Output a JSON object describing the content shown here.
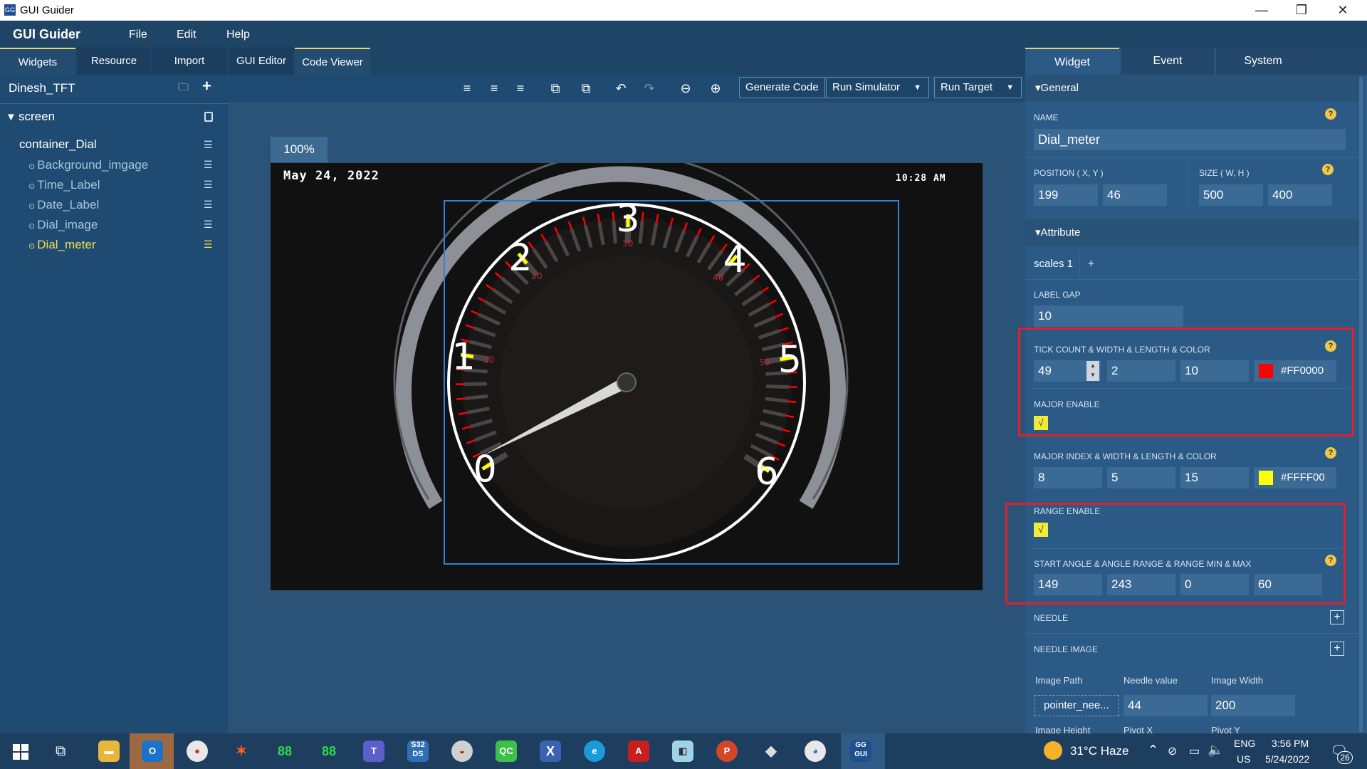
{
  "window": {
    "title": "GUI Guider",
    "minimize": "—",
    "restore": "❐",
    "close": "✕"
  },
  "menu": {
    "brand": "GUI Guider",
    "items": [
      "File",
      "Edit",
      "Help"
    ]
  },
  "left_tabs": [
    "Widgets",
    "Resource",
    "Import"
  ],
  "editor_tabs": [
    "GUI Editor",
    "Code Viewer"
  ],
  "project": {
    "name": "Dinesh_TFT"
  },
  "tree": {
    "root": "screen",
    "container": "container_Dial",
    "children": [
      "Background_imgage",
      "Time_Label",
      "Date_Label",
      "Dial_image",
      "Dial_meter"
    ]
  },
  "toolbar": {
    "generate": "Generate Code",
    "run_sim": "Run Simulator",
    "run_target": "Run Target"
  },
  "canvas": {
    "zoom": "100%",
    "date": "May 24, 2022",
    "time": "10:28 AM",
    "dial_labels": [
      "0",
      "1",
      "2",
      "3",
      "4",
      "5",
      "6"
    ],
    "dial_small_labels": [
      "10",
      "20",
      "30",
      "40",
      "50"
    ]
  },
  "right_tabs": [
    "Widget",
    "Event",
    "System"
  ],
  "general": {
    "header": "General",
    "name_label": "NAME",
    "name_value": "Dial_meter",
    "pos_label": "POSITION ( X, Y )",
    "pos_x": "199",
    "pos_y": "46",
    "size_label": "SIZE ( W, H )",
    "size_w": "500",
    "size_h": "400"
  },
  "attribute": {
    "header": "Attribute",
    "scales_tab": "scales 1",
    "add": "+",
    "label_gap_label": "LABEL GAP",
    "label_gap": "10",
    "tick_label": "TICK COUNT & WIDTH & LENGTH & COLOR",
    "tick_count": "49",
    "tick_width": "2",
    "tick_length": "10",
    "tick_color": "#FF0000",
    "major_enable_label": "MAJOR ENABLE",
    "major_label": "MAJOR INDEX & WIDTH & LENGTH & COLOR",
    "major_index": "8",
    "major_width": "5",
    "major_length": "15",
    "major_color": "#FFFF00",
    "range_enable_label": "RANGE ENABLE",
    "angle_label": "START ANGLE & ANGLE RANGE & RANGE MIN & MAX",
    "start_angle": "149",
    "angle_range": "243",
    "range_min": "0",
    "range_max": "60",
    "needle_label": "NEEDLE",
    "needle_image_label": "NEEDLE IMAGE",
    "img_path_label": "Image Path",
    "needle_value_label": "Needle value",
    "img_width_label": "Image Width",
    "img_path": "pointer_nee...",
    "needle_value": "44",
    "img_width": "200",
    "img_height_label": "Image Height",
    "pivot_x_label": "Pivot X",
    "pivot_y_label": "Pivot Y",
    "check": "√"
  },
  "taskbar": {
    "weather": "31°C  Haze",
    "lang1": "ENG",
    "lang2": "US",
    "time": "3:56 PM",
    "date": "5/24/2022",
    "notif": "26"
  },
  "colors": {
    "tick": "#FF0000",
    "major": "#FFFF00",
    "selection": "#2f82d6",
    "highlight": "#e0202a"
  }
}
